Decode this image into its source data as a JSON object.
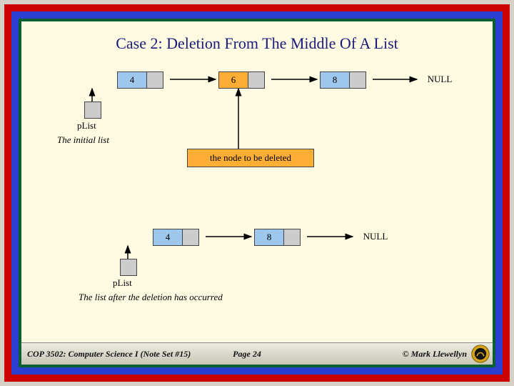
{
  "title": "Case 2: Deletion From The Middle Of A List",
  "before": {
    "head_label": "pList",
    "caption": "The initial list",
    "nodes": [
      {
        "value": "4",
        "style": "blue"
      },
      {
        "value": "6",
        "style": "orange"
      },
      {
        "value": "8",
        "style": "blue"
      }
    ],
    "terminator": "NULL",
    "delete_note": "the node to be deleted"
  },
  "after": {
    "head_label": "pList",
    "caption": "The list after the deletion has occurred",
    "nodes": [
      {
        "value": "4",
        "style": "blue"
      },
      {
        "value": "8",
        "style": "blue"
      }
    ],
    "terminator": "NULL"
  },
  "footer": {
    "left": "COP 3502: Computer Science I  (Note Set #15)",
    "mid": "Page 24",
    "right": "© Mark Llewellyn"
  },
  "icon": "pegasus-seal"
}
